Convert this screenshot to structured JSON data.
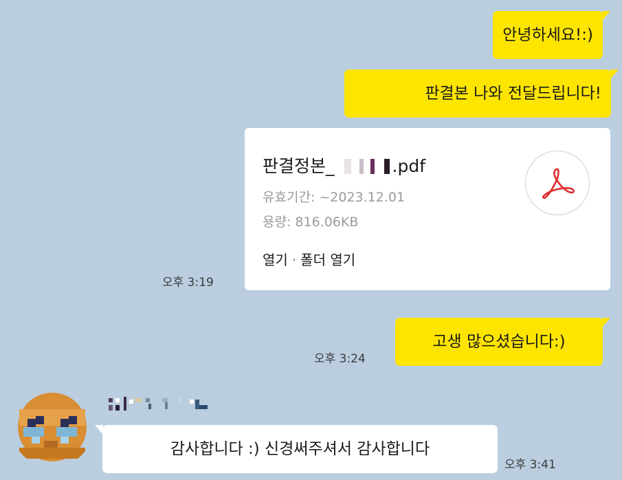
{
  "messages": {
    "greeting": "안녕하세요!:)",
    "delivery": "판결본 나와 전달드립니다!",
    "thanks_out": "고생 많으셨습니다:)",
    "reply": "감사합니다 :) 신경써주셔서 감사합니다"
  },
  "file": {
    "name_prefix": "판결정본_",
    "name_suffix": ".pdf",
    "expiry": "유효기간: ~2023.12.01",
    "size": "용량: 816.06KB",
    "open_label": "열기",
    "separator": "·",
    "open_folder_label": "폴더 열기",
    "icon": "pdf-icon"
  },
  "times": {
    "file_time": "오후 3:19",
    "thanks_time": "오후 3:24",
    "reply_time": "오후 3:41"
  },
  "colors": {
    "background": "#bacee0",
    "my_bubble": "#fee500",
    "other_bubble": "#ffffff",
    "pdf_accent": "#e02b2b"
  }
}
